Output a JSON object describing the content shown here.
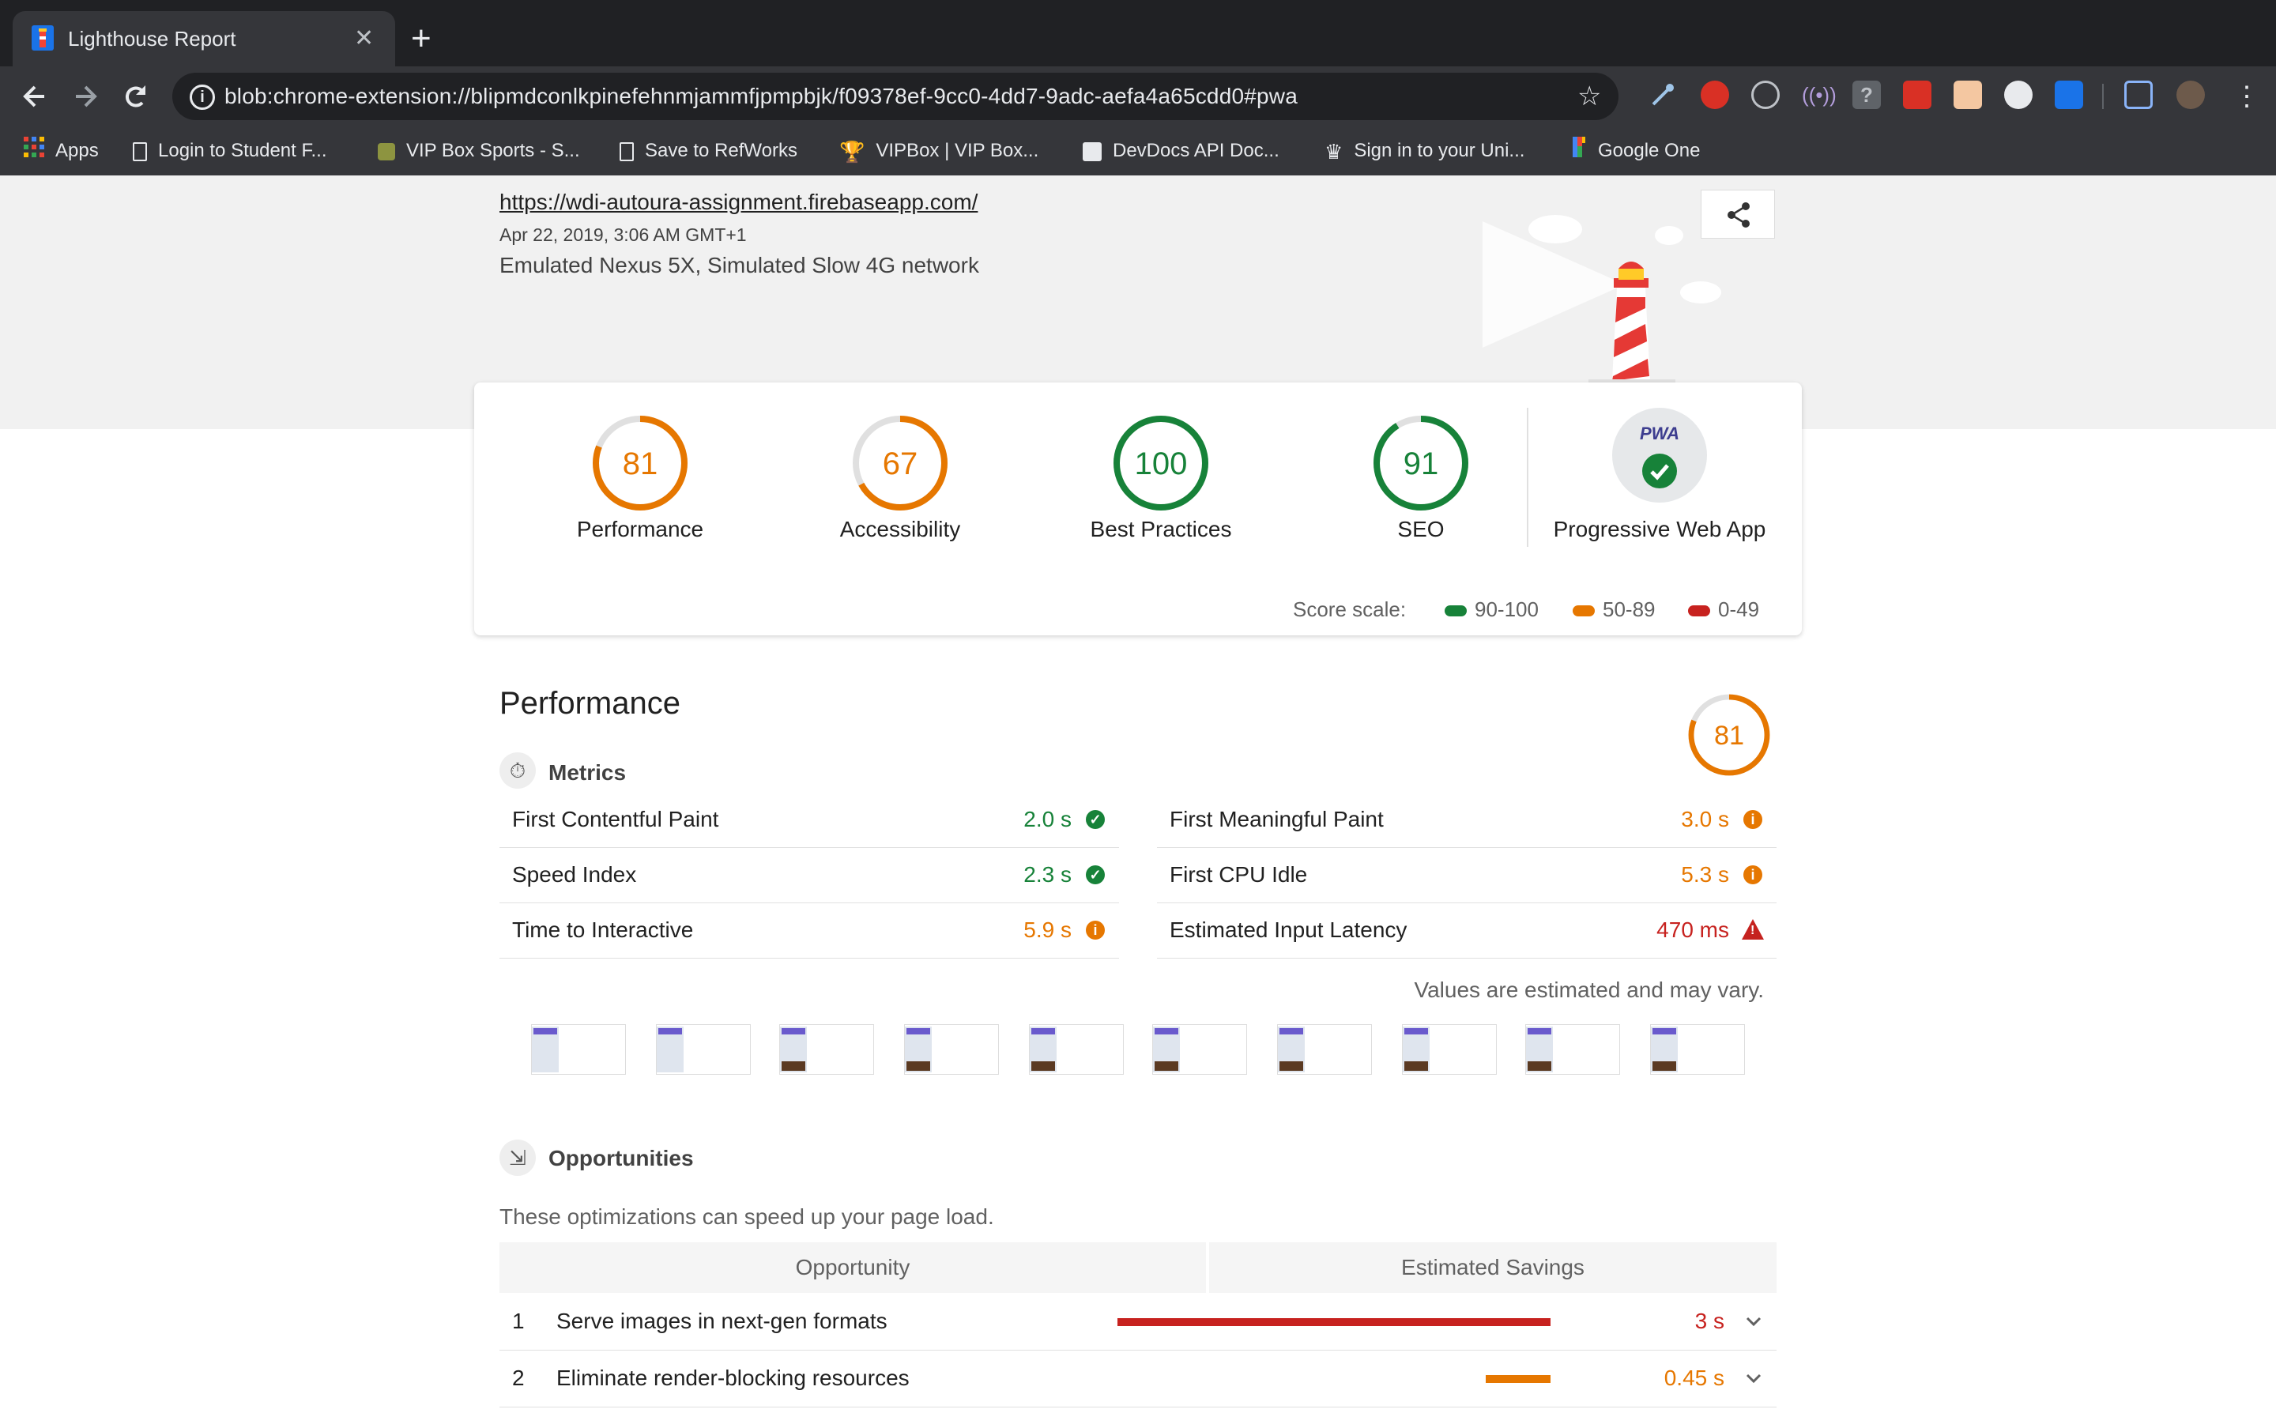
{
  "browser": {
    "tab_title": "Lighthouse Report",
    "tab_close": "✕",
    "new_tab": "+",
    "url": "blob:chrome-extension://blipmdconlkpinefehnmjammfjpmpbjk/f09378ef-9cc0-4dd7-9adc-aefa4a65cdd0#pwa",
    "bookmarks": [
      {
        "label": "Apps",
        "icon": "apps-grid-icon"
      },
      {
        "label": "Login to Student F...",
        "icon": "page-icon"
      },
      {
        "label": "VIP Box Sports - S...",
        "icon": "vipbox-icon"
      },
      {
        "label": "Save to RefWorks",
        "icon": "page-icon"
      },
      {
        "label": "VIPBox | VIP Box...",
        "icon": "trophy-icon"
      },
      {
        "label": "DevDocs API Doc...",
        "icon": "devdocs-icon"
      },
      {
        "label": "Sign in to your Uni...",
        "icon": "crown-icon"
      },
      {
        "label": "Google One",
        "icon": "google-one-icon"
      }
    ]
  },
  "report": {
    "url": "https://wdi-autoura-assignment.firebaseapp.com/",
    "date": "Apr 22, 2019, 3:06 AM GMT+1",
    "environment": "Emulated Nexus 5X, Simulated Slow 4G network"
  },
  "scores": [
    {
      "label": "Performance",
      "score": 81,
      "color": "#e67700"
    },
    {
      "label": "Accessibility",
      "score": 67,
      "color": "#e67700"
    },
    {
      "label": "Best Practices",
      "score": 100,
      "color": "#178239"
    },
    {
      "label": "SEO",
      "score": 91,
      "color": "#178239"
    }
  ],
  "pwa": {
    "label": "Progressive Web App",
    "badge": "PWA",
    "status": "passed"
  },
  "score_scale": {
    "title": "Score scale:",
    "items": [
      {
        "label": "90-100",
        "color": "#178239"
      },
      {
        "label": "50-89",
        "color": "#e67700"
      },
      {
        "label": "0-49",
        "color": "#c7221f"
      }
    ]
  },
  "performance": {
    "title": "Performance",
    "score": 81,
    "metrics_title": "Metrics",
    "metrics": [
      {
        "label": "First Contentful Paint",
        "value": "2.0 s",
        "status": "pass"
      },
      {
        "label": "First Meaningful Paint",
        "value": "3.0 s",
        "status": "average"
      },
      {
        "label": "Speed Index",
        "value": "2.3 s",
        "status": "pass"
      },
      {
        "label": "First CPU Idle",
        "value": "5.3 s",
        "status": "average"
      },
      {
        "label": "Time to Interactive",
        "value": "5.9 s",
        "status": "average"
      },
      {
        "label": "Estimated Input Latency",
        "value": "470 ms",
        "status": "fail"
      }
    ],
    "values_note": "Values are estimated and may vary.",
    "opportunities_title": "Opportunities",
    "opportunities_desc": "These optimizations can speed up your page load.",
    "opportunity_headers": [
      "Opportunity",
      "Estimated Savings"
    ],
    "opportunities": [
      {
        "num": "1",
        "label": "Serve images in next-gen formats",
        "value": "3 s",
        "fraction": 1.0,
        "color": "#c7221f"
      },
      {
        "num": "2",
        "label": "Eliminate render-blocking resources",
        "value": "0.45 s",
        "fraction": 0.15,
        "color": "#e67700"
      }
    ]
  },
  "colors": {
    "pass": "#178239",
    "average": "#e67700",
    "fail": "#c7221f"
  }
}
